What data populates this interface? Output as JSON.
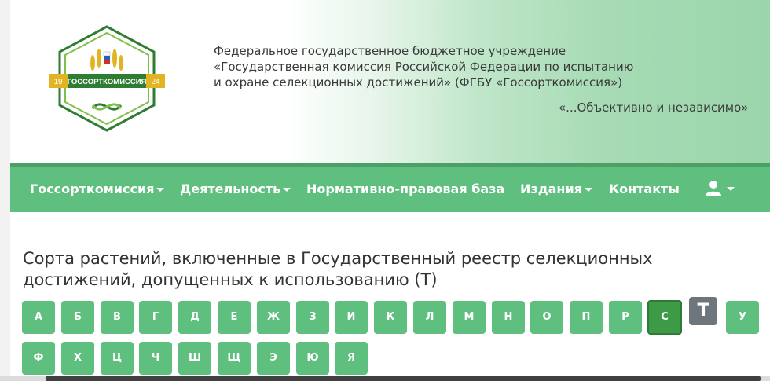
{
  "header": {
    "logo_text": "ГОССОРТКОМИССИЯ",
    "logo_year_left": "19",
    "logo_year_right": "24",
    "org_line1": "Федеральное государственное бюджетное учреждение",
    "org_line2": "«Государственная комиссия Российской Федерации по испытанию",
    "org_line3": "и охране селекционных достижений» (ФГБУ «Госсорткомиссия»)",
    "motto": "«...Объективно и независимо»"
  },
  "nav": {
    "items": [
      {
        "label": "Госсорткомиссия",
        "dropdown": true
      },
      {
        "label": "Деятельность",
        "dropdown": true
      },
      {
        "label": "Нормативно-правовая база",
        "dropdown": false
      },
      {
        "label": "Издания",
        "dropdown": true
      },
      {
        "label": "Контакты",
        "dropdown": false
      }
    ],
    "user_icon": "user-icon"
  },
  "main": {
    "title": "Сорта растений, включенные в Государственный реестр селекционных достижений, допущенных к использованию (Т)",
    "letters_row1": [
      "А",
      "Б",
      "В",
      "Г",
      "Д",
      "Е",
      "Ж",
      "З",
      "И",
      "К",
      "Л",
      "М",
      "Н",
      "О",
      "П",
      "Р",
      "С",
      "Т",
      "У"
    ],
    "letters_row2": [
      "Ф",
      "Х",
      "Ц",
      "Ч",
      "Ш",
      "Щ",
      "Э",
      "Ю",
      "Я"
    ],
    "active_letter": "С",
    "current_letter": "Т"
  },
  "colors": {
    "nav_bg": "#5fbf7f",
    "letter_bg": "#5fbf7f",
    "active_bg": "#3d9a47",
    "current_bg": "#6d757d"
  }
}
